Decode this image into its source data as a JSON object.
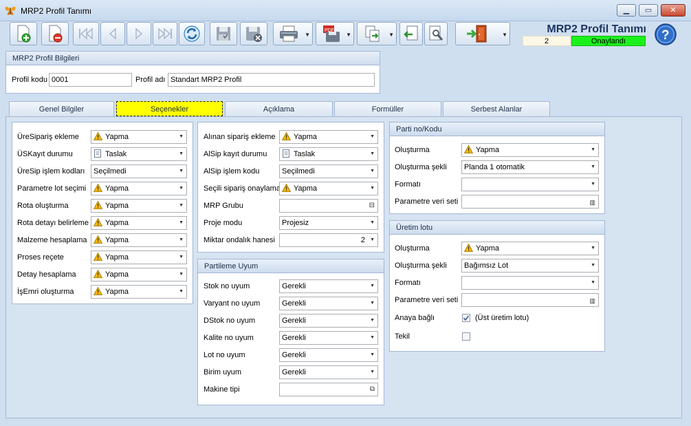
{
  "window": {
    "title": "MRP2 Profil Tanımı"
  },
  "header": {
    "title": "MRP2 Profil Tanımı",
    "record_number": "2",
    "status": "Onaylandı"
  },
  "colors": {
    "status_bg": "#1cf01c",
    "active_tab": "#ffff00",
    "warning": "#f2b705"
  },
  "toolbar_icons": [
    "new-document-icon",
    "delete-document-icon",
    "first-record-icon",
    "previous-record-icon",
    "next-record-icon",
    "last-record-icon",
    "refresh-icon",
    "save-icon",
    "discard-icon",
    "print-icon",
    "pdf-export-icon",
    "copy-icon",
    "import-icon",
    "tools-icon",
    "exit-door-icon",
    "help-icon"
  ],
  "info": {
    "title": "MRP2 Profil Bilgileri",
    "code_label": "Profil kodu",
    "code_value": "0001",
    "name_label": "Profil adı",
    "name_value": "Standart MRP2 Profil"
  },
  "tabs": [
    "Genel Bilgiler",
    "Seçenekler",
    "Açıklama",
    "Formüller",
    "Serbest Alanlar"
  ],
  "col1": [
    {
      "label": "ÜreSipariş ekleme",
      "value": "Yapma",
      "icon": "warning"
    },
    {
      "label": "ÜSKayıt durumu",
      "value": "Taslak",
      "icon": "draft"
    },
    {
      "label": "ÜreSip işlem kodları",
      "value": "Seçilmedi",
      "icon": ""
    },
    {
      "label": "Parametre lot seçimi",
      "value": "Yapma",
      "icon": "warning"
    },
    {
      "label": "Rota oluşturma",
      "value": "Yapma",
      "icon": "warning"
    },
    {
      "label": "Rota detayı belirleme",
      "value": "Yapma",
      "icon": "warning"
    },
    {
      "label": "Malzeme hesaplama",
      "value": "Yapma",
      "icon": "warning"
    },
    {
      "label": "Proses reçete",
      "value": "Yapma",
      "icon": "warning"
    },
    {
      "label": "Detay hesaplama",
      "value": "Yapma",
      "icon": "warning"
    },
    {
      "label": "İşEmri oluşturma",
      "value": "Yapma",
      "icon": "warning"
    }
  ],
  "col2": [
    {
      "label": "Alınan sipariş ekleme",
      "value": "Yapma",
      "icon": "warning"
    },
    {
      "label": "AlSip kayıt durumu",
      "value": "Taslak",
      "icon": "draft"
    },
    {
      "label": "AlSip işlem kodu",
      "value": "Seçilmedi",
      "icon": ""
    },
    {
      "label": "Seçili sipariş onaylama",
      "value": "Yapma",
      "icon": "warning"
    },
    {
      "label": "MRP Grubu",
      "value": "",
      "icon": ""
    },
    {
      "label": "Proje modu",
      "value": "Projesiz",
      "icon": ""
    },
    {
      "label": "Miktar ondalık hanesi",
      "value": "2",
      "icon": ""
    }
  ],
  "partileme": {
    "title": "Partileme Uyum",
    "rows": [
      {
        "label": "Stok no uyum",
        "value": "Gerekli"
      },
      {
        "label": "Varyant no uyum",
        "value": "Gerekli"
      },
      {
        "label": "DStok no uyum",
        "value": "Gerekli"
      },
      {
        "label": "Kalite no uyum",
        "value": "Gerekli"
      },
      {
        "label": "Lot no uyum",
        "value": "Gerekli"
      },
      {
        "label": "Birim uyum",
        "value": "Gerekli"
      },
      {
        "label": "Makine tipi",
        "value": ""
      }
    ]
  },
  "parti": {
    "title": "Parti no/Kodu",
    "olusturma_label": "Oluşturma",
    "olusturma_value": "Yapma",
    "sekli_label": "Oluşturma şekli",
    "sekli_value": "Planda 1 otomatik",
    "format_label": "Formatı",
    "format_value": "",
    "param_label": "Parametre veri seti",
    "param_value": ""
  },
  "uretim": {
    "title": "Üretim lotu",
    "olusturma_label": "Oluşturma",
    "olusturma_value": "Yapma",
    "sekli_label": "Oluşturma şekli",
    "sekli_value": "Bağımsız Lot",
    "format_label": "Formatı",
    "format_value": "",
    "param_label": "Parametre veri seti",
    "param_value": "",
    "anaya_label": "Anaya bağlı",
    "anaya_note": "(Üst üretim lotu)",
    "anaya_checked": true,
    "tekil_label": "Tekil",
    "tekil_checked": false
  }
}
